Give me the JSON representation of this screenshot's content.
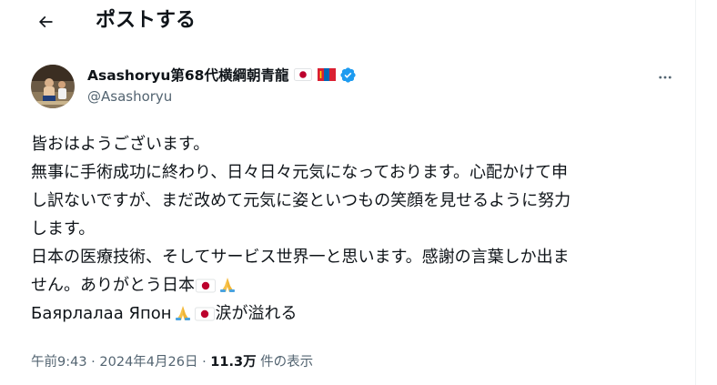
{
  "header": {
    "title": "ポストする"
  },
  "author": {
    "display_name": "Asashoryu第68代横綱朝青龍",
    "handle": "@Asashoryu"
  },
  "post": {
    "line1": "皆おはようございます。",
    "line2": "無事に手術成功に終わり、日々日々元気になっております。心配かけて申",
    "line3": "し訳ないですが、まだ改めて元気に姿といつもの笑顔を見せるように努力",
    "line4": "します。",
    "line5": "日本の医療技術、そしてサービス世界一と思います。感謝の言葉しか出ま",
    "line6": "せん。ありがとう日本",
    "line7a": "Баярлалаа Япон",
    "line7b": "涙が溢れる"
  },
  "meta": {
    "time": "午前9:43",
    "sep1": "·",
    "date": "2024年4月26日",
    "sep2": "·",
    "views": "11.3万",
    "views_label": " 件の表示"
  },
  "colors": {
    "verified": "#1d9bf0",
    "text": "#0f1419",
    "secondary": "#536471",
    "flag_red": "#bc002d"
  },
  "icons": [
    "back-arrow-icon",
    "verified-badge-icon",
    "more-options-icon",
    "japan-flag-icon",
    "mongolia-flag-icon",
    "folded-hands-icon"
  ]
}
